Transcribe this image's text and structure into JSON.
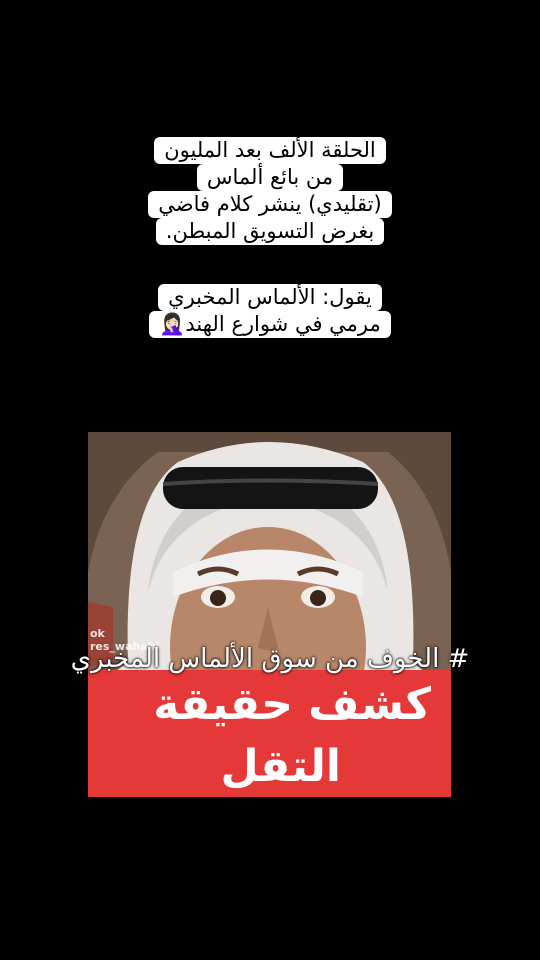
{
  "caption": {
    "block1": [
      "الحلقة الألف بعد المليون",
      "من بائع ألماس",
      "(تقليدي) ينشر كلام فاضي",
      "بغرض التسويق المبطن."
    ],
    "block2": [
      "يقول: الألماس المخبري",
      "مرمي في شوارع الهند🤦🏻‍♀️"
    ]
  },
  "video": {
    "watermark_line1": "ok",
    "watermark_line2": "res_wahabi",
    "banner_line1": "كشف حقيقة",
    "banner_line2": "التقل"
  },
  "hashtag": "# الخوف من سوق الألماس المخبري",
  "colors": {
    "background": "#000000",
    "caption_bg": "#ffffff",
    "banner_red": "#e53838"
  }
}
